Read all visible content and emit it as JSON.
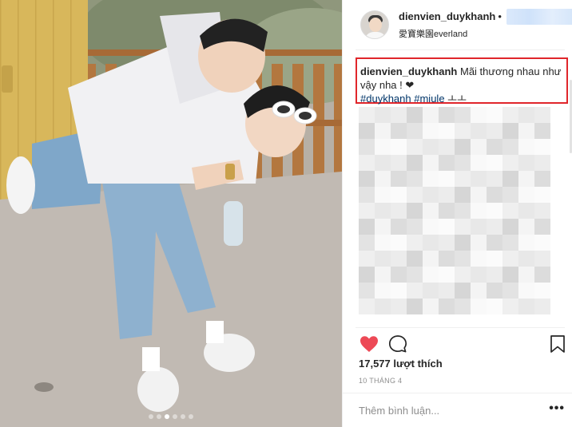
{
  "post": {
    "username": "dienvien_duykhanh",
    "separator": "•",
    "location": "愛寶樂園everland",
    "caption": {
      "username": "dienvien_duykhanh",
      "text": " Mãi thương nhau như vậy nha ! ❤",
      "hashtag_1": "#duykhanh",
      "hashtag_2": "#miule",
      "trailing": " ㅗㅗ"
    },
    "likes": "17,577 lượt thích",
    "date": "10 THÁNG 4",
    "comment_placeholder": "Thêm bình luận...",
    "more_options": "•••"
  },
  "icons": {
    "like": "heart-icon",
    "comment": "comment-icon",
    "save": "bookmark-icon"
  },
  "carousel": {
    "count": 6,
    "active_index": 2
  },
  "colors": {
    "like": "#ed4956",
    "highlight_box": "#e0262b",
    "hashtag": "#003569",
    "muted": "#8e8e8e"
  }
}
